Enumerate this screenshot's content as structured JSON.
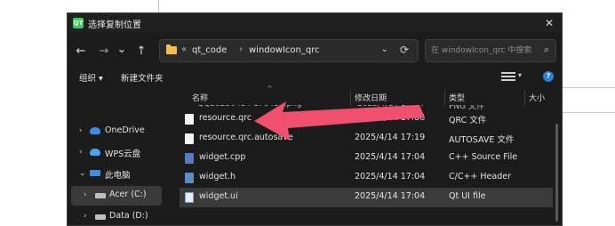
{
  "window": {
    "app_icon_text": "QT",
    "title": "选择复制位置",
    "close_glyph": "✕"
  },
  "nav": {
    "back": "←",
    "forward": "→",
    "recent": "⌄",
    "up": "↑"
  },
  "address": {
    "overflow": "«",
    "crumbs": [
      "qt_code",
      "windowIcon_qrc"
    ],
    "separator": "›",
    "dropdown": "⌄",
    "refresh": "⟳"
  },
  "search": {
    "placeholder": "在 windowIcon_qrc 中搜索",
    "icon": "⌕"
  },
  "toolbar": {
    "organize": "组织 ▾",
    "new_folder": "新建文件夹",
    "view_dropdown": "▾",
    "help": "?"
  },
  "sidebar": {
    "items": [
      {
        "label": "OneDrive",
        "chevron": "›",
        "icon": "cloud-icon"
      },
      {
        "label": "WPS云盘",
        "chevron": "›",
        "icon": "cloud-icon"
      },
      {
        "label": "此电脑",
        "chevron": "⌄",
        "icon": "computer-icon"
      },
      {
        "label": "Acer (C:)",
        "chevron": "›",
        "icon": "drive-icon"
      },
      {
        "label": "Data (D:)",
        "chevron": "›",
        "icon": "drive-icon"
      }
    ]
  },
  "columns": {
    "name": "名称",
    "date": "修改日期",
    "type": "类型",
    "size": "大小",
    "sort": "^"
  },
  "files": [
    {
      "name": "resource.qrc",
      "date": "2025/4/14 17:06",
      "type": "QRC 文件",
      "icon": "file-icon"
    },
    {
      "name": "resource.qrc.autosave",
      "date": "2025/4/14 17:19",
      "type": "AUTOSAVE 文件",
      "icon": "file-icon"
    },
    {
      "name": "widget.cpp",
      "date": "2025/4/14 17:04",
      "type": "C++ Source File",
      "icon": "cpp-file-icon"
    },
    {
      "name": "widget.h",
      "date": "2025/4/14 17:04",
      "type": "C/C++ Header",
      "icon": "header-file-icon"
    },
    {
      "name": "widget.ui",
      "date": "2025/4/14 17:04",
      "type": "Qt UI file",
      "icon": "ui-file-icon"
    }
  ],
  "colors": {
    "dialog_bg": "#1c1c1c",
    "selected_row": "#3b3b3b",
    "annotation_arrow": "#f0506e",
    "accent": "#2b7fd8"
  }
}
